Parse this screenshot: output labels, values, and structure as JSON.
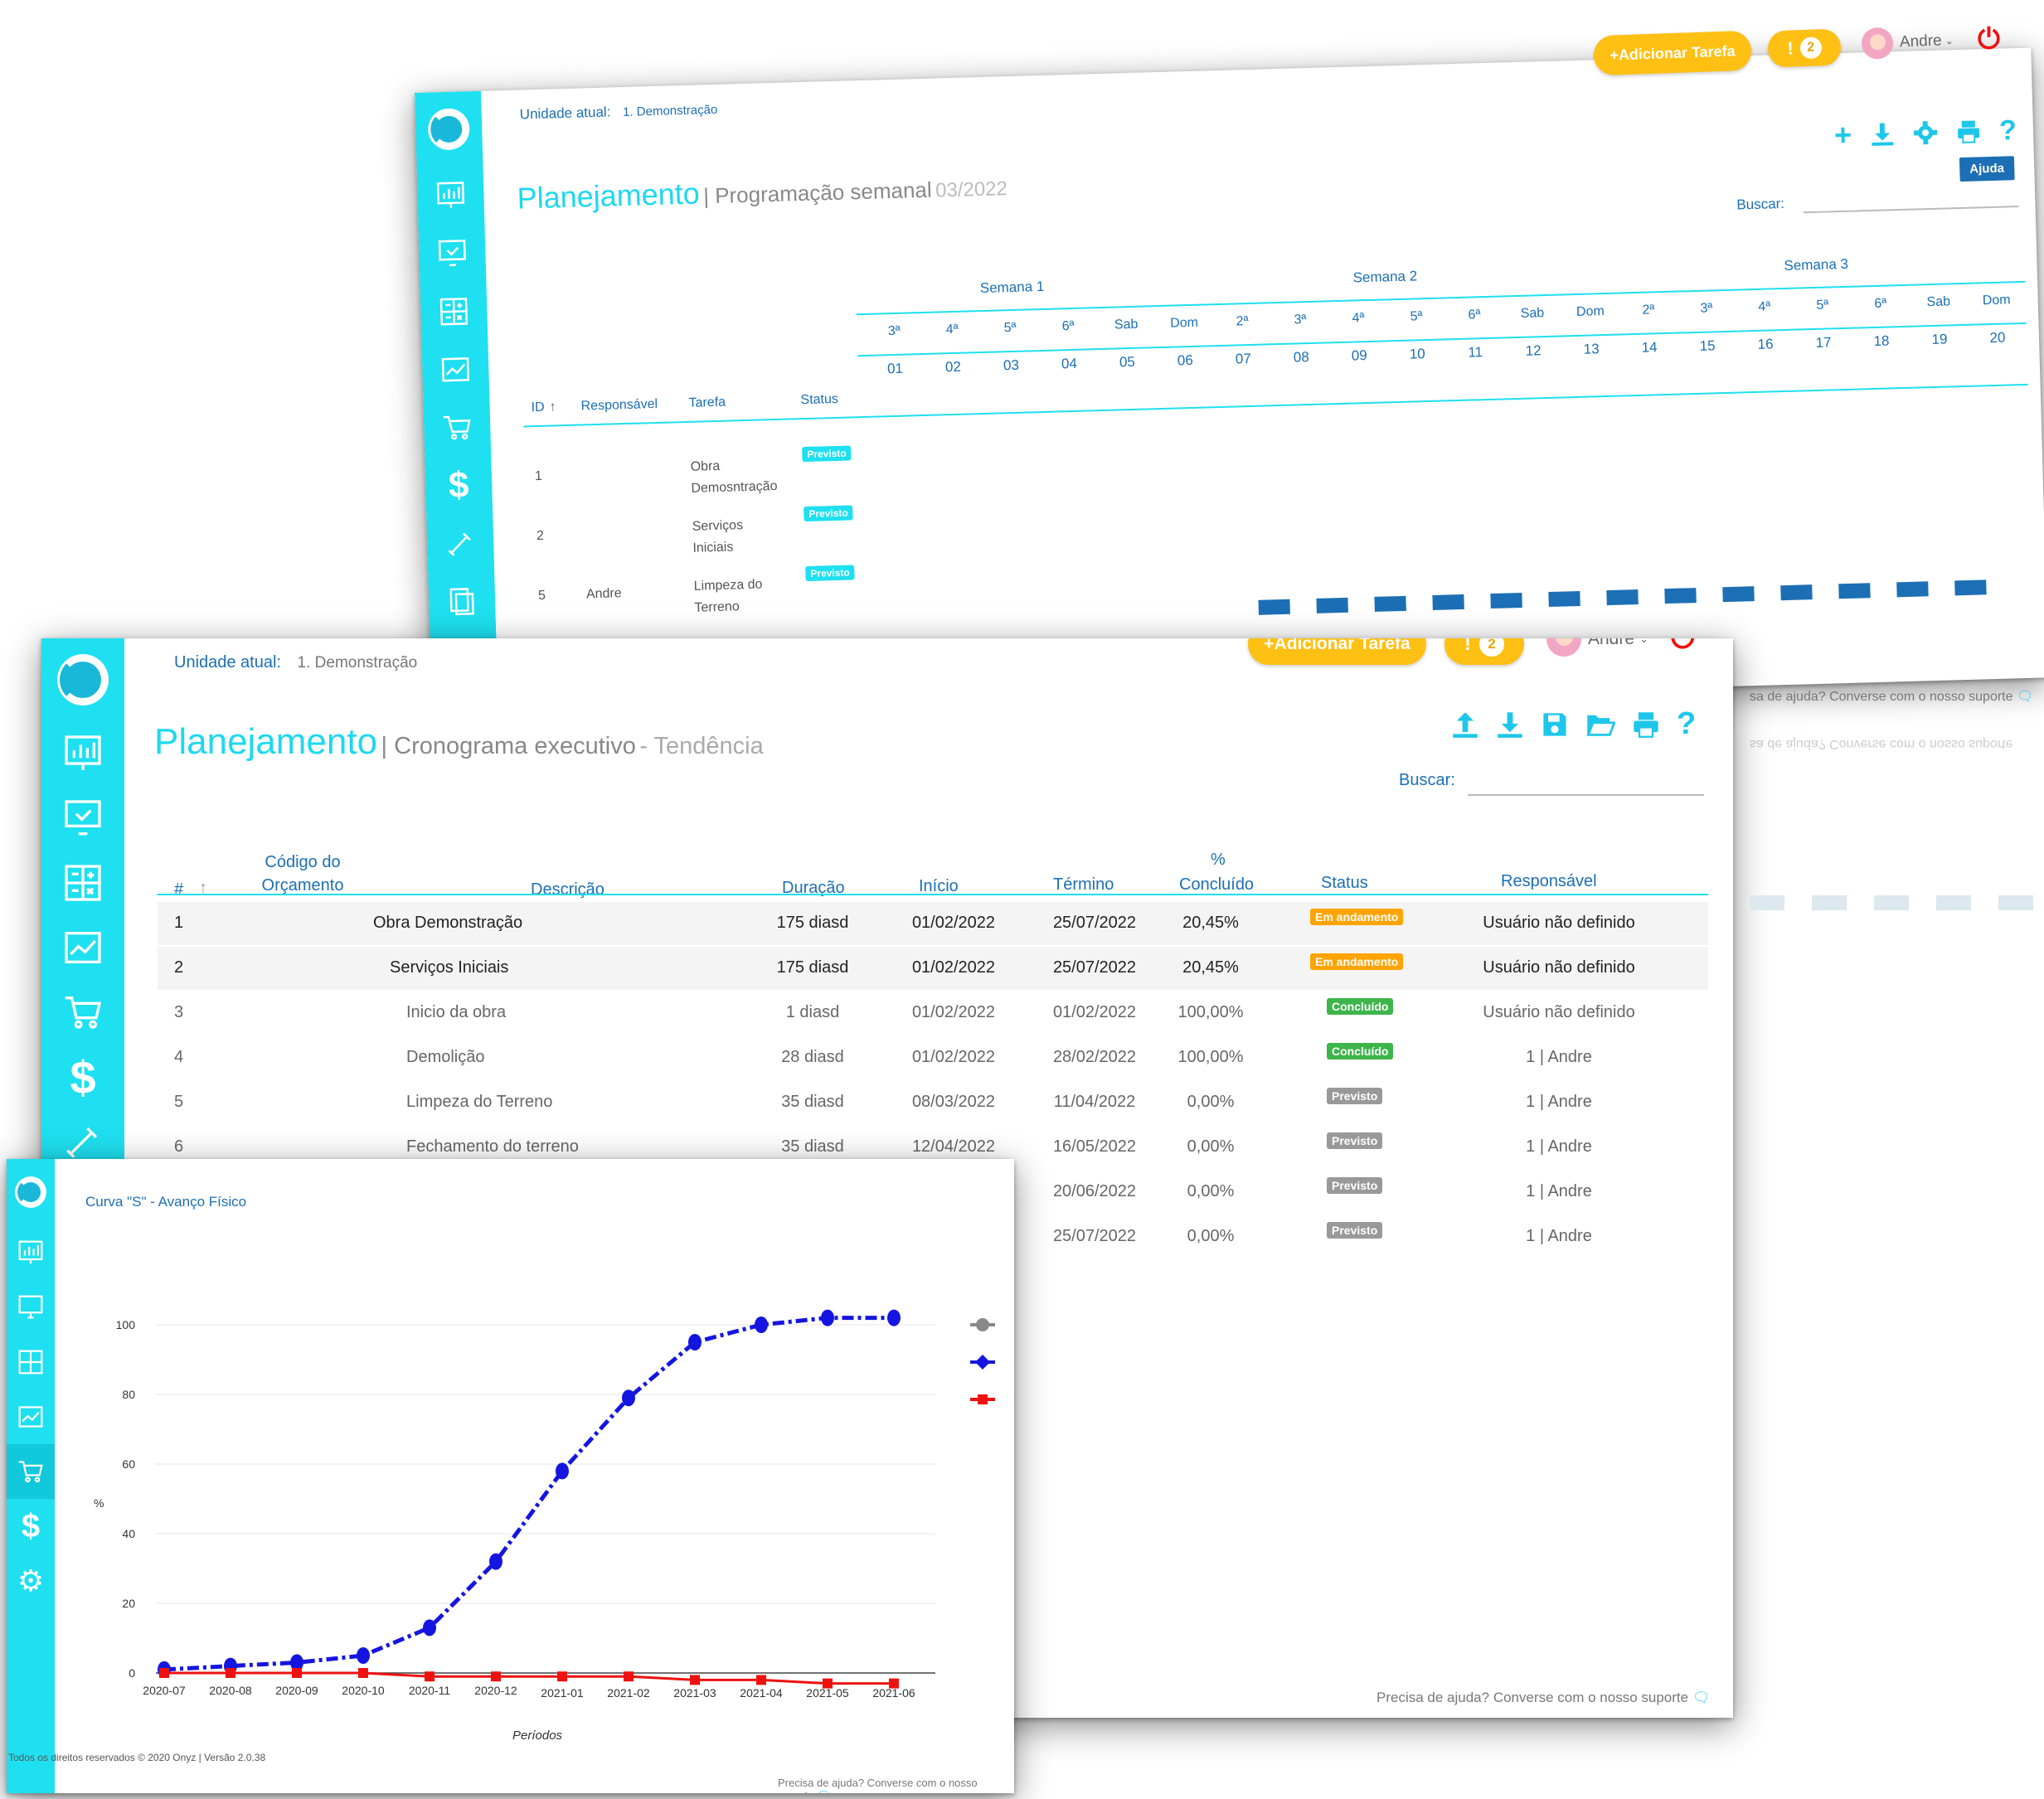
{
  "colors": {
    "accent": "#1ee0f0",
    "brand_blue": "#1c6fb5",
    "warning": "#ffc014",
    "in_progress": "#ffa400",
    "done": "#3db54a",
    "planned": "#999999",
    "danger": "#e11111"
  },
  "header": {
    "add_task_label": "Adicionar Tarefa",
    "alert_icon": "!",
    "alert_count": "2",
    "user_name": "Andre"
  },
  "unit": {
    "label": "Unidade atual:",
    "value": "1. Demonstração"
  },
  "weekly": {
    "title": "Planejamento",
    "subtitle": "| Programação semanal",
    "period": "03/2022",
    "search_label": "Buscar:",
    "help_tooltip": "Ajuda",
    "weeks": [
      "Semana 1",
      "Semana 2",
      "Semana 3"
    ],
    "weekdays": [
      "3ª",
      "4ª",
      "5ª",
      "6ª",
      "Sab",
      "Dom",
      "2ª",
      "3ª",
      "4ª",
      "5ª",
      "6ª",
      "Sab",
      "Dom",
      "2ª",
      "3ª",
      "4ª",
      "5ª",
      "6ª",
      "Sab",
      "Dom"
    ],
    "days": [
      "01",
      "02",
      "03",
      "04",
      "05",
      "06",
      "07",
      "08",
      "09",
      "10",
      "11",
      "12",
      "13",
      "14",
      "15",
      "16",
      "17",
      "18",
      "19",
      "20"
    ],
    "columns": {
      "id": "ID",
      "sort": "↑",
      "responsavel": "Responsável",
      "tarefa": "Tarefa",
      "status": "Status"
    },
    "rows": [
      {
        "id": "1",
        "responsavel": "",
        "tarefa": "Obra Demosntração",
        "status": "Previsto"
      },
      {
        "id": "2",
        "responsavel": "",
        "tarefa": "Serviços Iniciais",
        "status": "Previsto"
      },
      {
        "id": "5",
        "responsavel": "Andre",
        "tarefa": "Limpeza do Terreno",
        "status": "Previsto"
      }
    ],
    "footer_help": "sa de ajuda? Converse com o nosso suporte",
    "reflection_text": "sa de ajuda? Converse com o nosso suporte"
  },
  "schedule": {
    "title": "Planejamento",
    "subtitle": "| Cronograma executivo",
    "mode": "- Tendência",
    "search_label": "Buscar:",
    "columns": {
      "num": "#",
      "sort": "↑",
      "codigo": "Código do Orçamento",
      "descricao": "Descrição",
      "duracao": "Duração",
      "inicio": "Início",
      "termino": "Término",
      "pct_symbol": "%",
      "pct_label": "Concluído",
      "status": "Status",
      "responsavel": "Responsável"
    },
    "rows": [
      {
        "n": "1",
        "desc": "Obra Demonstração",
        "dur": "175 diasd",
        "ini": "01/02/2022",
        "fim": "25/07/2022",
        "pct": "20,45%",
        "status": "Em andamento",
        "resp": "Usuário não definido"
      },
      {
        "n": "2",
        "desc": "Serviços Iniciais",
        "dur": "175 diasd",
        "ini": "01/02/2022",
        "fim": "25/07/2022",
        "pct": "20,45%",
        "status": "Em andamento",
        "resp": "Usuário não definido"
      },
      {
        "n": "3",
        "desc": "Inicio da obra",
        "dur": "1 diasd",
        "ini": "01/02/2022",
        "fim": "01/02/2022",
        "pct": "100,00%",
        "status": "Concluído",
        "resp": "Usuário não definido"
      },
      {
        "n": "4",
        "desc": "Demolição",
        "dur": "28 diasd",
        "ini": "01/02/2022",
        "fim": "28/02/2022",
        "pct": "100,00%",
        "status": "Concluído",
        "resp": "1 | Andre"
      },
      {
        "n": "5",
        "desc": "Limpeza do Terreno",
        "dur": "35 diasd",
        "ini": "08/03/2022",
        "fim": "11/04/2022",
        "pct": "0,00%",
        "status": "Previsto",
        "resp": "1 | Andre"
      },
      {
        "n": "6",
        "desc": "Fechamento do terreno",
        "dur": "35 diasd",
        "ini": "12/04/2022",
        "fim": "16/05/2022",
        "pct": "0,00%",
        "status": "Previsto",
        "resp": "1 | Andre"
      },
      {
        "n": "",
        "desc": "",
        "dur": "",
        "ini": "",
        "fim": "20/06/2022",
        "pct": "0,00%",
        "status": "Previsto",
        "resp": "1 | Andre"
      },
      {
        "n": "",
        "desc": "",
        "dur": "",
        "ini": "",
        "fim": "25/07/2022",
        "pct": "0,00%",
        "status": "Previsto",
        "resp": "1 | Andre"
      }
    ],
    "footer_help": "Precisa de ajuda? Converse com o nosso suporte"
  },
  "curve": {
    "title": "Curva \"S\" - Avanço Físico",
    "copyright": "Todos os direitos reservados © 2020 Onyz | Versão 2.0.38",
    "footer_help": "Precisa de ajuda? Converse com o nosso suporte"
  },
  "chart_data": {
    "type": "line",
    "title": "Curva \"S\" - Avanço Físico",
    "xlabel": "Períodos",
    "ylabel": "%",
    "ylim": [
      0,
      100
    ],
    "yticks": [
      "0",
      "20",
      "40",
      "60",
      "80",
      "100"
    ],
    "categories": [
      "2020-07",
      "2020-08",
      "2020-09",
      "2020-10",
      "2020-11",
      "2020-12",
      "2021-01",
      "2021-02",
      "2021-03",
      "2021-04",
      "2021-05",
      "2021-06"
    ],
    "series": [
      {
        "color": "#1515e0",
        "marker": "diamond",
        "values": [
          1,
          2,
          3,
          5,
          13,
          32,
          58,
          79,
          95,
          100,
          102,
          102
        ]
      },
      {
        "color": "#ee1111",
        "marker": "square",
        "values": [
          0,
          0,
          0,
          0,
          -1,
          -1,
          -1,
          -1,
          -2,
          -2,
          -3,
          -3
        ]
      }
    ],
    "legend": "right",
    "legend_marker_colors": [
      "#888888",
      "#1515e0",
      "#ee1111"
    ],
    "grid": true
  }
}
